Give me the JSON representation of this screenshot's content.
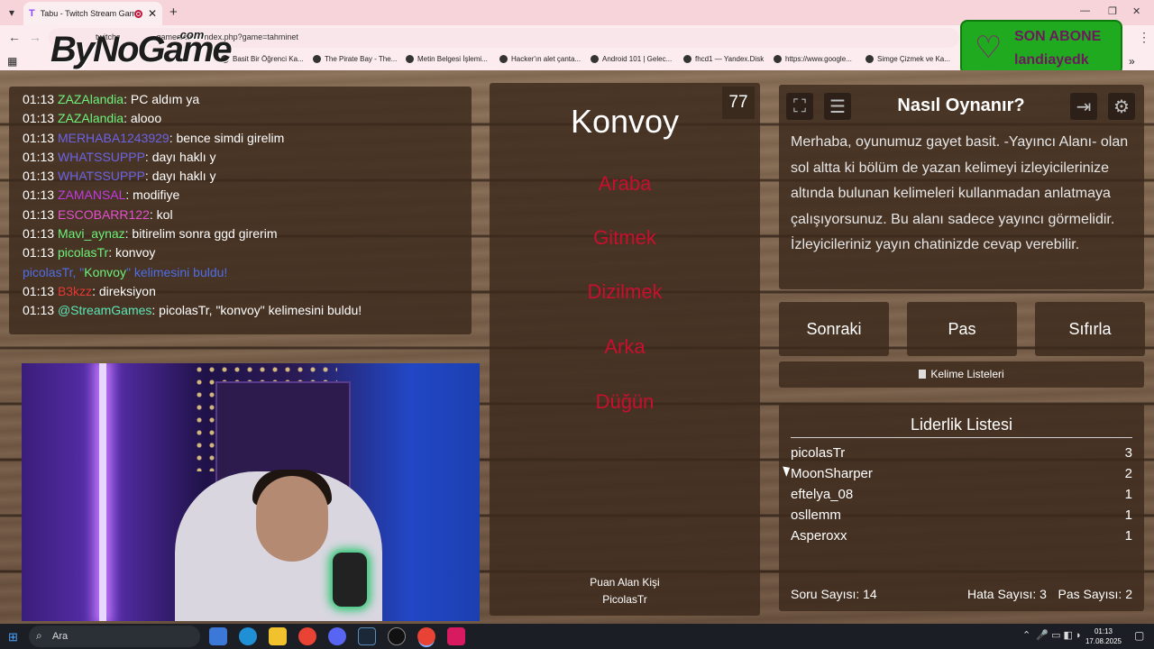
{
  "browser": {
    "tab_title": "Tabu - Twitch Stream Game",
    "tab_favicon": "T",
    "url_before": "twitchs",
    "url_after": "games.co",
    "url_tail": "ndex.php?game=tahminet",
    "bookmarks": [
      "Basit Bir Öğrenci Ka...",
      "The Pirate Bay - The...",
      "Metin Belgesi İşlemi...",
      "Hacker'ın alet çanta...",
      "Android 101 | Gelec...",
      "fhcd1 — Yandex.Disk",
      "https://www.google...",
      "Simge Çizmek ve Ka..."
    ]
  },
  "overlay": {
    "logo": "ByNoGame",
    "logo_com": ".com",
    "sub_alert_title": "SON ABONE",
    "sub_alert_name": "landiayedk"
  },
  "chat": {
    "messages": [
      {
        "time": "01:13",
        "user": "ZAZAlandia",
        "color": "#6cf27a",
        "text": ": PC aldım ya"
      },
      {
        "time": "01:13",
        "user": "ZAZAlandia",
        "color": "#6cf27a",
        "text": ": alooo"
      },
      {
        "time": "01:13",
        "user": "MERHABA1243929",
        "color": "#6b63e6",
        "text": ": bence simdi girelim"
      },
      {
        "time": "01:13",
        "user": "WHATSSUPPP",
        "color": "#6b63e6",
        "text": ": dayı haklı y"
      },
      {
        "time": "01:13",
        "user": "WHATSSUPPP",
        "color": "#6b63e6",
        "text": ": dayı haklı y"
      },
      {
        "time": "01:13",
        "user": "ZAMANSAL",
        "color": "#c23be0",
        "text": ": modifiye"
      },
      {
        "time": "01:13",
        "user": "ESCOBARR122",
        "color": "#e54fd0",
        "text": ": kol"
      },
      {
        "time": "01:13",
        "user": "Mavi_aynaz",
        "color": "#6cf27a",
        "text": ": bitirelim sonra ggd girerim"
      },
      {
        "time": "01:13",
        "user": "picolasTr",
        "color": "#6cf27a",
        "text": ": konvoy"
      },
      {
        "time": "01:13",
        "user": "B3kzz",
        "color": "#e53935",
        "text": ": direksiyon"
      },
      {
        "time": "01:13",
        "user": "@StreamGames",
        "color": "#5be6b6",
        "text": ": picolasTr, \"konvoy\" kelimesini buldu!"
      }
    ],
    "system": {
      "user": "picolasTr",
      "mid": ", \"",
      "word": "Konvoy",
      "end": "\" kelimesini buldu!"
    }
  },
  "game": {
    "timer": "77",
    "word": "Konvoy",
    "taboo_words": [
      "Araba",
      "Gitmek",
      "Dizilmek",
      "Arka",
      "Düğün"
    ],
    "scorer_label": "Puan Alan Kişi",
    "scorer_name": "PicolasTr"
  },
  "how": {
    "title": "Nasıl Oynanır?",
    "text": "Merhaba, oyunumuz gayet basit. -Yayıncı Alanı- olan sol altta ki bölüm de yazan kelimeyi izleyicilerinize altında bulunan kelimeleri kullanmadan anlatmaya çalışıyorsunuz. Bu alanı sadece yayıncı görmelidir. İzleyicileriniz yayın chatinizde cevap verebilir."
  },
  "buttons": {
    "next": "Sonraki",
    "pass": "Pas",
    "reset": "Sıfırla",
    "lists": "Kelime Listeleri"
  },
  "leaderboard": {
    "title": "Liderlik Listesi",
    "rows": [
      {
        "name": "picolasTr",
        "score": "3"
      },
      {
        "name": "MoonSharper",
        "score": "2"
      },
      {
        "name": "eftelya_08",
        "score": "1"
      },
      {
        "name": "osllemm",
        "score": "1"
      },
      {
        "name": "Asperoxx",
        "score": "1"
      }
    ],
    "questions": "Soru Sayısı: 14",
    "errors": "Hata Sayısı: 3",
    "passes": "Pas Sayısı: 2"
  },
  "taskbar": {
    "search": "Ara",
    "time": "01:13",
    "date": "17.08.2025"
  },
  "colors": {
    "taboo": "#c8102e",
    "sub_alert_bg": "#1faa1f",
    "system_blue": "#4f6ee6",
    "system_word": "#6cf27a"
  }
}
